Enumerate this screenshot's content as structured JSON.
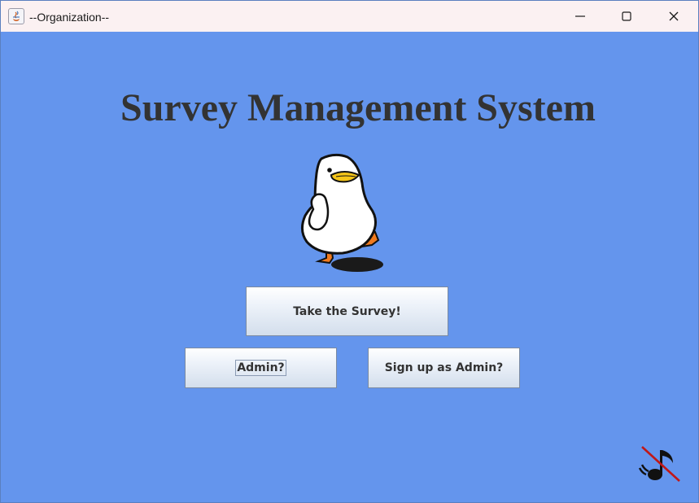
{
  "window": {
    "title": "--Organization--",
    "controls": {
      "minimize_icon": "minimize-icon",
      "maximize_icon": "maximize-icon",
      "close_icon": "close-icon"
    }
  },
  "main": {
    "heading": "Survey Management System",
    "mascot_icon": "duck-icon",
    "buttons": {
      "take_survey": "Take the Survey!",
      "admin": "Admin?",
      "sign_up_admin": "Sign up as Admin?"
    },
    "music_toggle_icon": "music-muted-icon"
  },
  "colors": {
    "background": "#6495ed",
    "titlebar": "#fbf1f2",
    "heading_text": "#333333",
    "button_text": "#333333",
    "mute_slash": "#c01818"
  }
}
